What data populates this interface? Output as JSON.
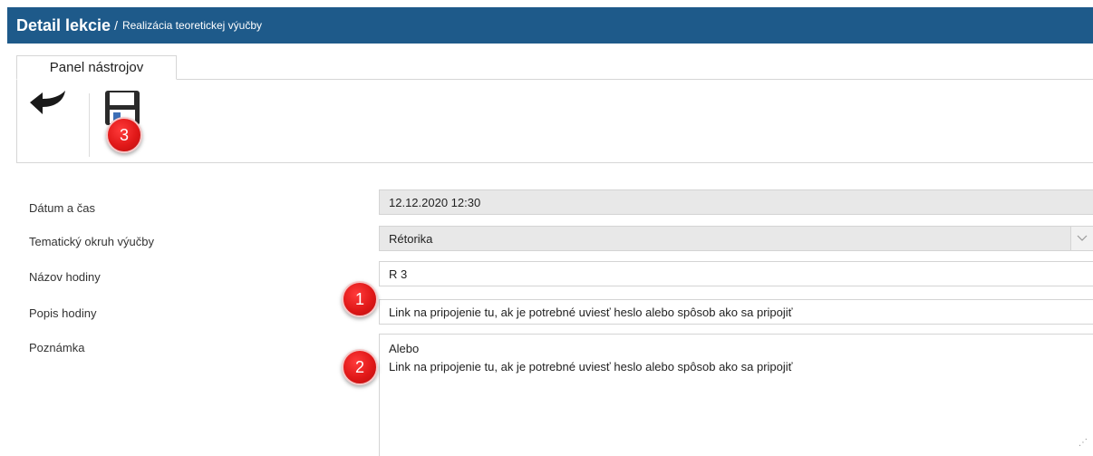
{
  "header": {
    "title": "Detail lekcie",
    "separator": "/",
    "subtitle": "Realizácia teoretickej výučby",
    "background": "#1e5a8a"
  },
  "toolbar": {
    "tab_label": "Panel nástrojov",
    "buttons": [
      {
        "name": "back",
        "icon": "back-arrow-icon"
      },
      {
        "name": "save",
        "icon": "floppy-disk-icon"
      }
    ]
  },
  "badges": {
    "one": "1",
    "two": "2",
    "three": "3",
    "color": "#e01818"
  },
  "form": {
    "datetime": {
      "label": "Dátum a čas",
      "value": "12.12.2020 12:30"
    },
    "topic": {
      "label": "Tematický okruh výučby",
      "value": "Rétorika"
    },
    "lesson_name": {
      "label": "Názov hodiny",
      "value": "R 3"
    },
    "lesson_description": {
      "label": "Popis hodiny",
      "value": "Link na pripojenie tu, ak je potrebné uviesť heslo alebo spôsob ako sa pripojiť"
    },
    "note": {
      "label": "Poznámka",
      "line1": "Alebo",
      "line2": "Link na pripojenie tu, ak je potrebné uviesť heslo alebo spôsob ako sa pripojiť"
    }
  }
}
